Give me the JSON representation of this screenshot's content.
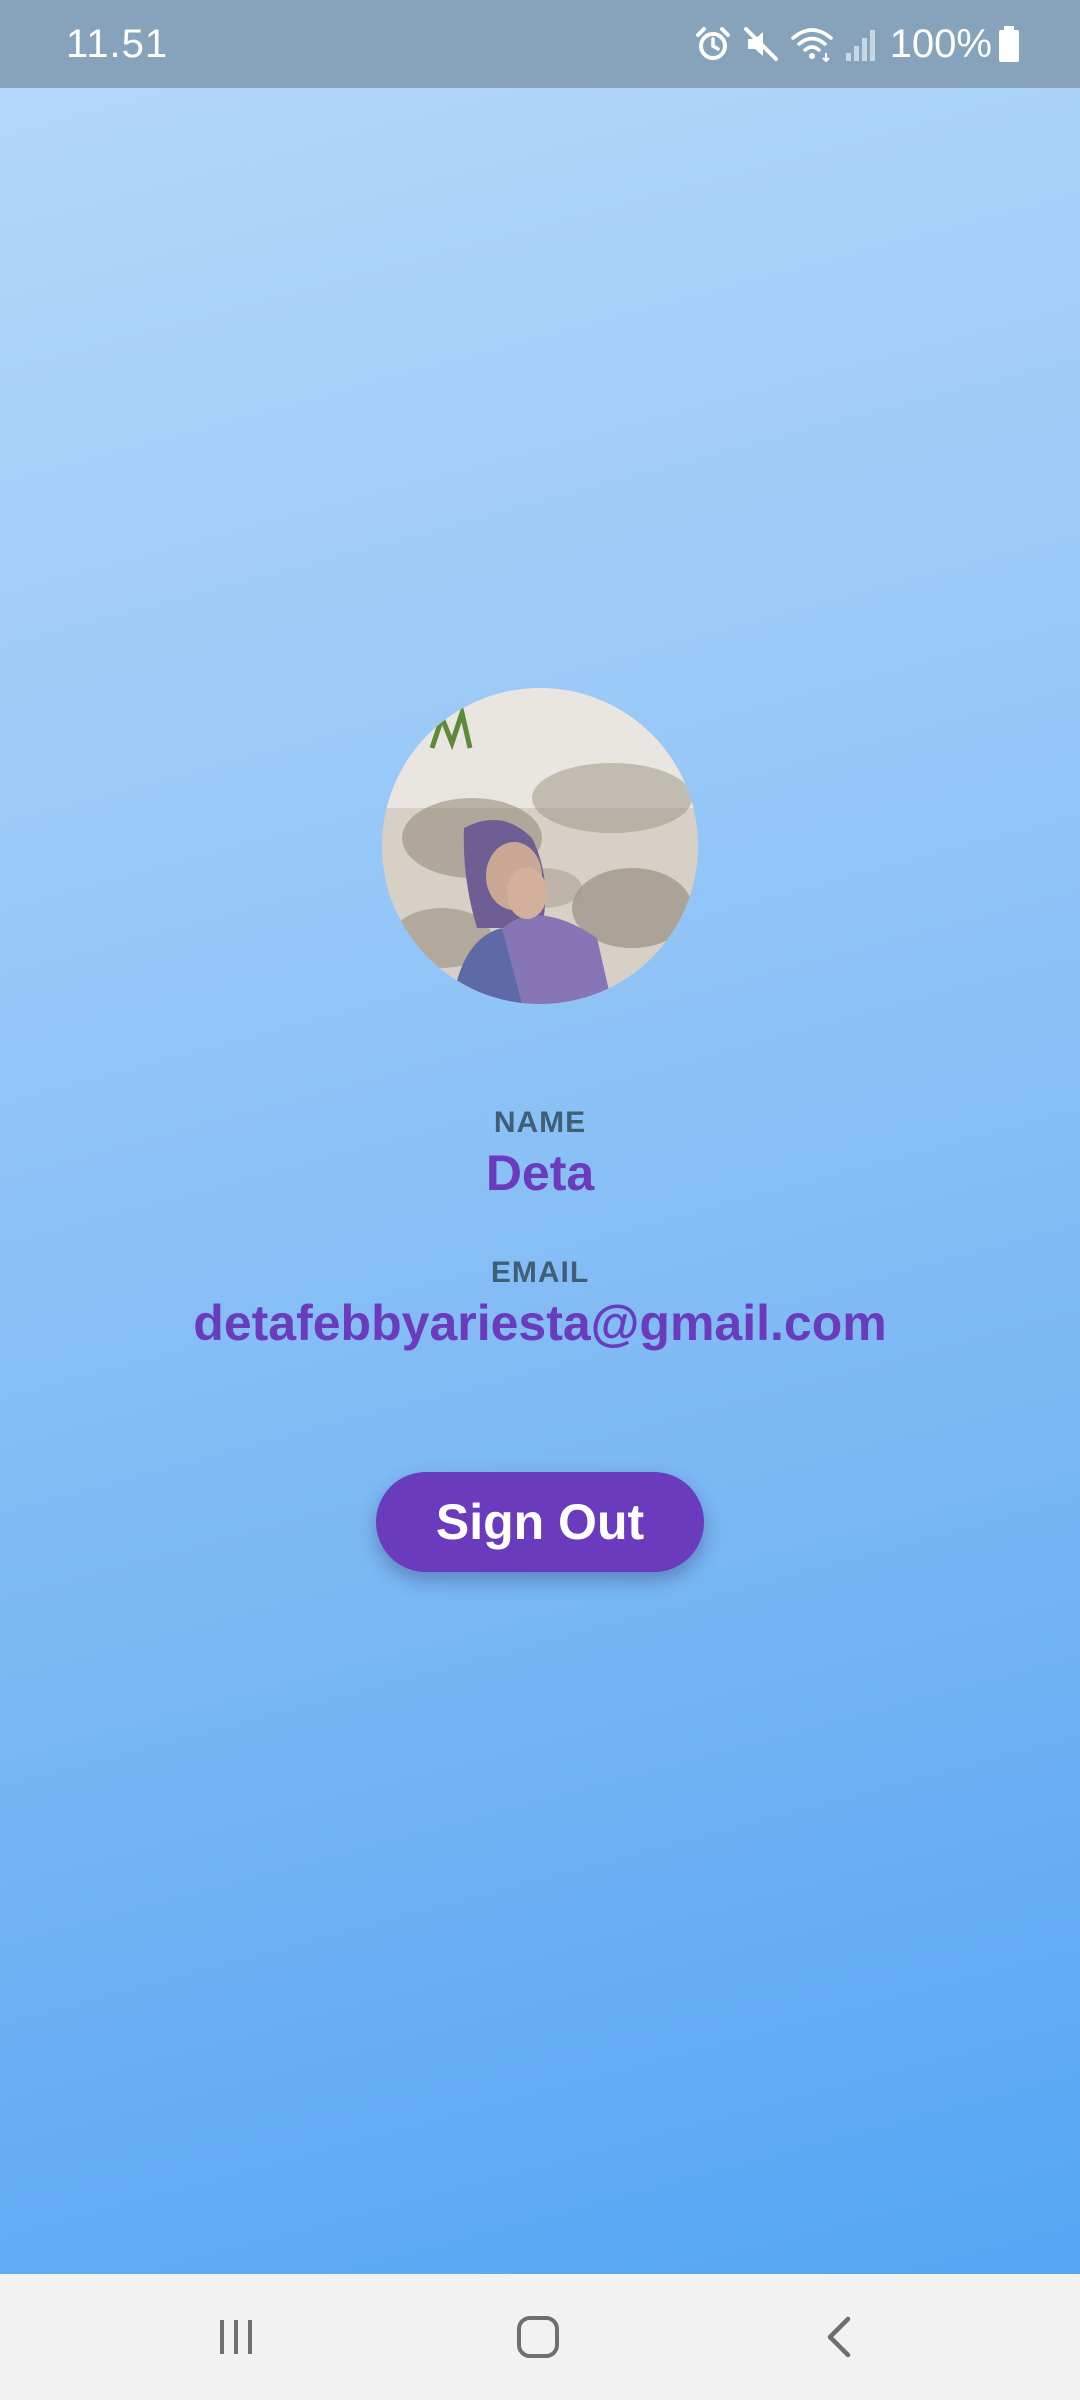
{
  "status_bar": {
    "time": "11.51",
    "battery": "100%",
    "icons": [
      "alarm-icon",
      "mute-icon",
      "wifi-icon",
      "signal-icon",
      "battery-icon"
    ]
  },
  "profile": {
    "avatar": "profile-photo",
    "name_label": "NAME",
    "name": "Deta",
    "email_label": "EMAIL",
    "email": "detafebbyariesta@gmail.com"
  },
  "actions": {
    "sign_out": "Sign Out"
  },
  "nav_bar": {
    "buttons": [
      "recents-icon",
      "home-icon",
      "back-icon"
    ]
  },
  "colors": {
    "accent": "#6a3bbd",
    "label": "#3f5f78",
    "status_bar": "#86a3bb",
    "nav_bar": "#f2f2f2"
  }
}
